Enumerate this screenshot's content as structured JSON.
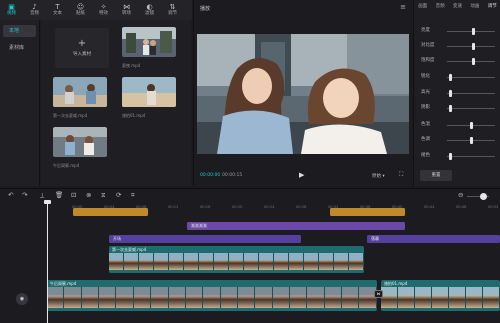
{
  "toolbar": {
    "items": [
      {
        "label": "视频",
        "icon": "media-icon",
        "glyph": "▣",
        "active": true
      },
      {
        "label": "音频",
        "icon": "audio-icon",
        "glyph": "♪"
      },
      {
        "label": "文本",
        "icon": "text-icon",
        "glyph": "T"
      },
      {
        "label": "贴纸",
        "icon": "sticker-icon",
        "glyph": "☺"
      },
      {
        "label": "特效",
        "icon": "effects-icon",
        "glyph": "✧"
      },
      {
        "label": "转场",
        "icon": "transition-icon",
        "glyph": "⋈"
      },
      {
        "label": "滤镜",
        "icon": "filter-icon",
        "glyph": "◐"
      },
      {
        "label": "调节",
        "icon": "adjust-icon",
        "glyph": "⇅"
      }
    ]
  },
  "sidebar": {
    "items": [
      {
        "label": "本地",
        "active": true
      },
      {
        "label": "素材库",
        "active": false
      }
    ]
  },
  "media": {
    "import_label": "导入素材",
    "import_glyph": "+",
    "clips": [
      {
        "caption": "夏夜.mp4"
      },
      {
        "caption": "第一次去夏威.mp4"
      },
      {
        "caption": "旅拍01.mp4"
      },
      {
        "caption": "午后闺蜜.mp4"
      }
    ]
  },
  "player": {
    "title": "播放",
    "menu_glyph": "≡",
    "current_time": "00:00:00",
    "total_time": "00:00:15",
    "play_glyph": "▶",
    "ratio_label": "原始 ▾",
    "fullscreen_glyph": "⛶"
  },
  "adjust": {
    "tabs": [
      "画面",
      "音频",
      "变速",
      "动画",
      "调节"
    ],
    "active_tab": 4,
    "sliders": [
      {
        "name": "亮度",
        "level": 0.55
      },
      {
        "name": "对比度",
        "level": 0.55
      },
      {
        "name": "饱和度",
        "level": 0.55
      },
      {
        "name": "锐化",
        "level": 0.05
      },
      {
        "name": "高光",
        "level": 0.05
      },
      {
        "name": "阴影",
        "level": 0.05
      },
      {
        "name": "色温",
        "level": 0.5
      },
      {
        "name": "色调",
        "level": 0.5
      },
      {
        "name": "褪色",
        "level": 0.05
      }
    ],
    "reset_label": "重置"
  },
  "timeline": {
    "tools": [
      {
        "icon": "undo-icon",
        "glyph": "↶"
      },
      {
        "icon": "redo-icon",
        "glyph": "↷"
      },
      {
        "icon": "split-icon",
        "glyph": "⟂"
      },
      {
        "icon": "delete-icon",
        "glyph": "🗑"
      },
      {
        "icon": "freeze-icon",
        "glyph": "⊡"
      },
      {
        "icon": "reverse-icon",
        "glyph": "⊗"
      },
      {
        "icon": "mirror-icon",
        "glyph": "⧖"
      },
      {
        "icon": "rotate-icon",
        "glyph": "⟳"
      },
      {
        "icon": "crop-icon",
        "glyph": "⌗"
      }
    ],
    "zoom_glyph": "⊖",
    "ruler": [
      "00:00",
      "00:04",
      "00:08",
      "00:12",
      "00:16",
      "00:20",
      "00:24",
      "00:28",
      "00:32",
      "00:36",
      "00:40",
      "00:44",
      "00:48",
      "00:52"
    ],
    "bars": [
      {
        "label": "",
        "color": "#c08a2b"
      },
      {
        "label": "",
        "color": "#c08a2b"
      },
      {
        "label": "渐渐渐渐",
        "color": "#6b4aa7"
      },
      {
        "label": "开场",
        "color": "#5540a0"
      },
      {
        "label": "落幕",
        "color": "#5540a0"
      }
    ],
    "clips": [
      {
        "label": "第一次去夏威.mp4"
      },
      {
        "label": "午后闺蜜.mp4"
      },
      {
        "label": "旅拍01.mp4"
      }
    ],
    "main_track_glyph": "◉",
    "split_glyph": "⋈"
  }
}
